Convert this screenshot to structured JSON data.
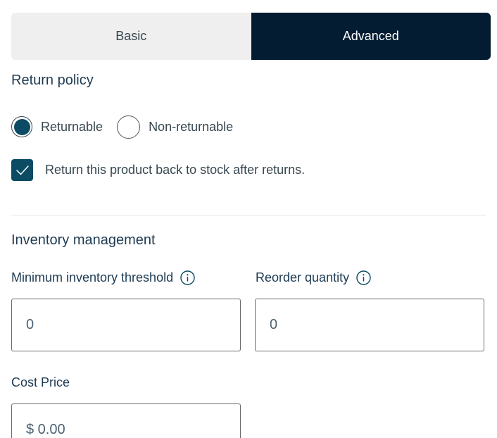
{
  "tabs": {
    "basic_label": "Basic",
    "advanced_label": "Advanced",
    "active": "Advanced"
  },
  "return_policy": {
    "title": "Return policy",
    "options": {
      "returnable": "Returnable",
      "non_returnable": "Non-returnable"
    },
    "selected": "Returnable",
    "restock_label": "Return this product back to stock after returns.",
    "restock_checked": true
  },
  "inventory": {
    "title": "Inventory management",
    "min_threshold_label": "Minimum inventory threshold",
    "min_threshold_value": "0",
    "reorder_label": "Reorder quantity",
    "reorder_value": "0"
  },
  "cost": {
    "label": "Cost Price",
    "value": "$ 0.00"
  },
  "colors": {
    "active_tab": "#041c32",
    "accent": "#0b4b63",
    "inactive_tab": "#efefef"
  },
  "icons": [
    "info-icon",
    "check-icon"
  ]
}
